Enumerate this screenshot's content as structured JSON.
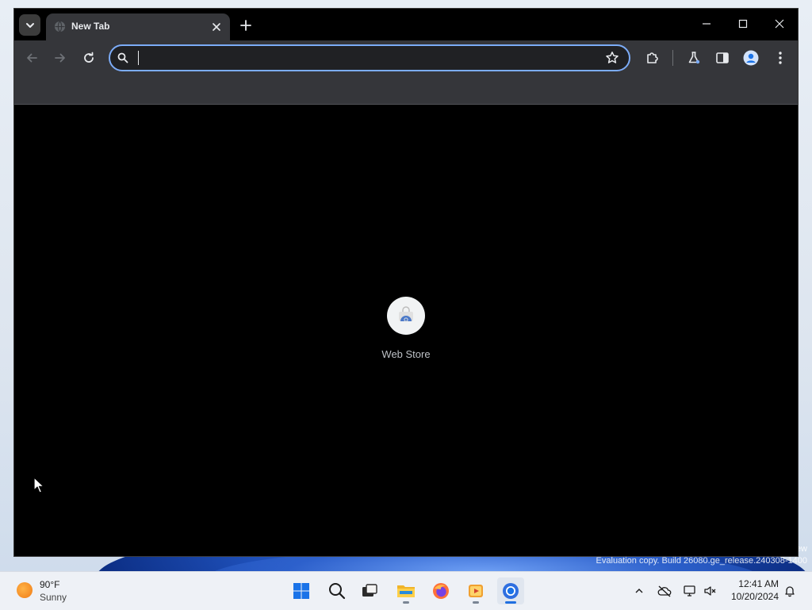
{
  "browser": {
    "tab": {
      "title": "New Tab"
    },
    "omnibox": {
      "value": "",
      "placeholder": ""
    },
    "toolbar_icons": [
      "back-arrow-icon",
      "forward-arrow-icon",
      "reload-icon",
      "star-icon",
      "extensions-icon",
      "labs-icon",
      "side-panel-icon",
      "profile-icon",
      "menu-icon"
    ],
    "shortcuts": [
      {
        "label": "Web Store",
        "icon": "web-store-icon"
      }
    ],
    "theme": {
      "accent": "#7cacf8",
      "frame": "#000000",
      "toolbar": "#35363a"
    }
  },
  "desktop": {
    "watermark_line1": "ew",
    "watermark_line2": "Evaluation copy. Build 26080.ge_release.240308-1400"
  },
  "taskbar": {
    "weather": {
      "temp": "90°F",
      "condition": "Sunny"
    },
    "apps": [
      "start-icon",
      "search-icon",
      "task-view-icon",
      "file-explorer-icon",
      "firefox-icon",
      "media-player-icon",
      "chrome-icon"
    ],
    "active_app": "chrome-icon",
    "clock": {
      "time": "12:41 AM",
      "date": "10/20/2024"
    }
  }
}
